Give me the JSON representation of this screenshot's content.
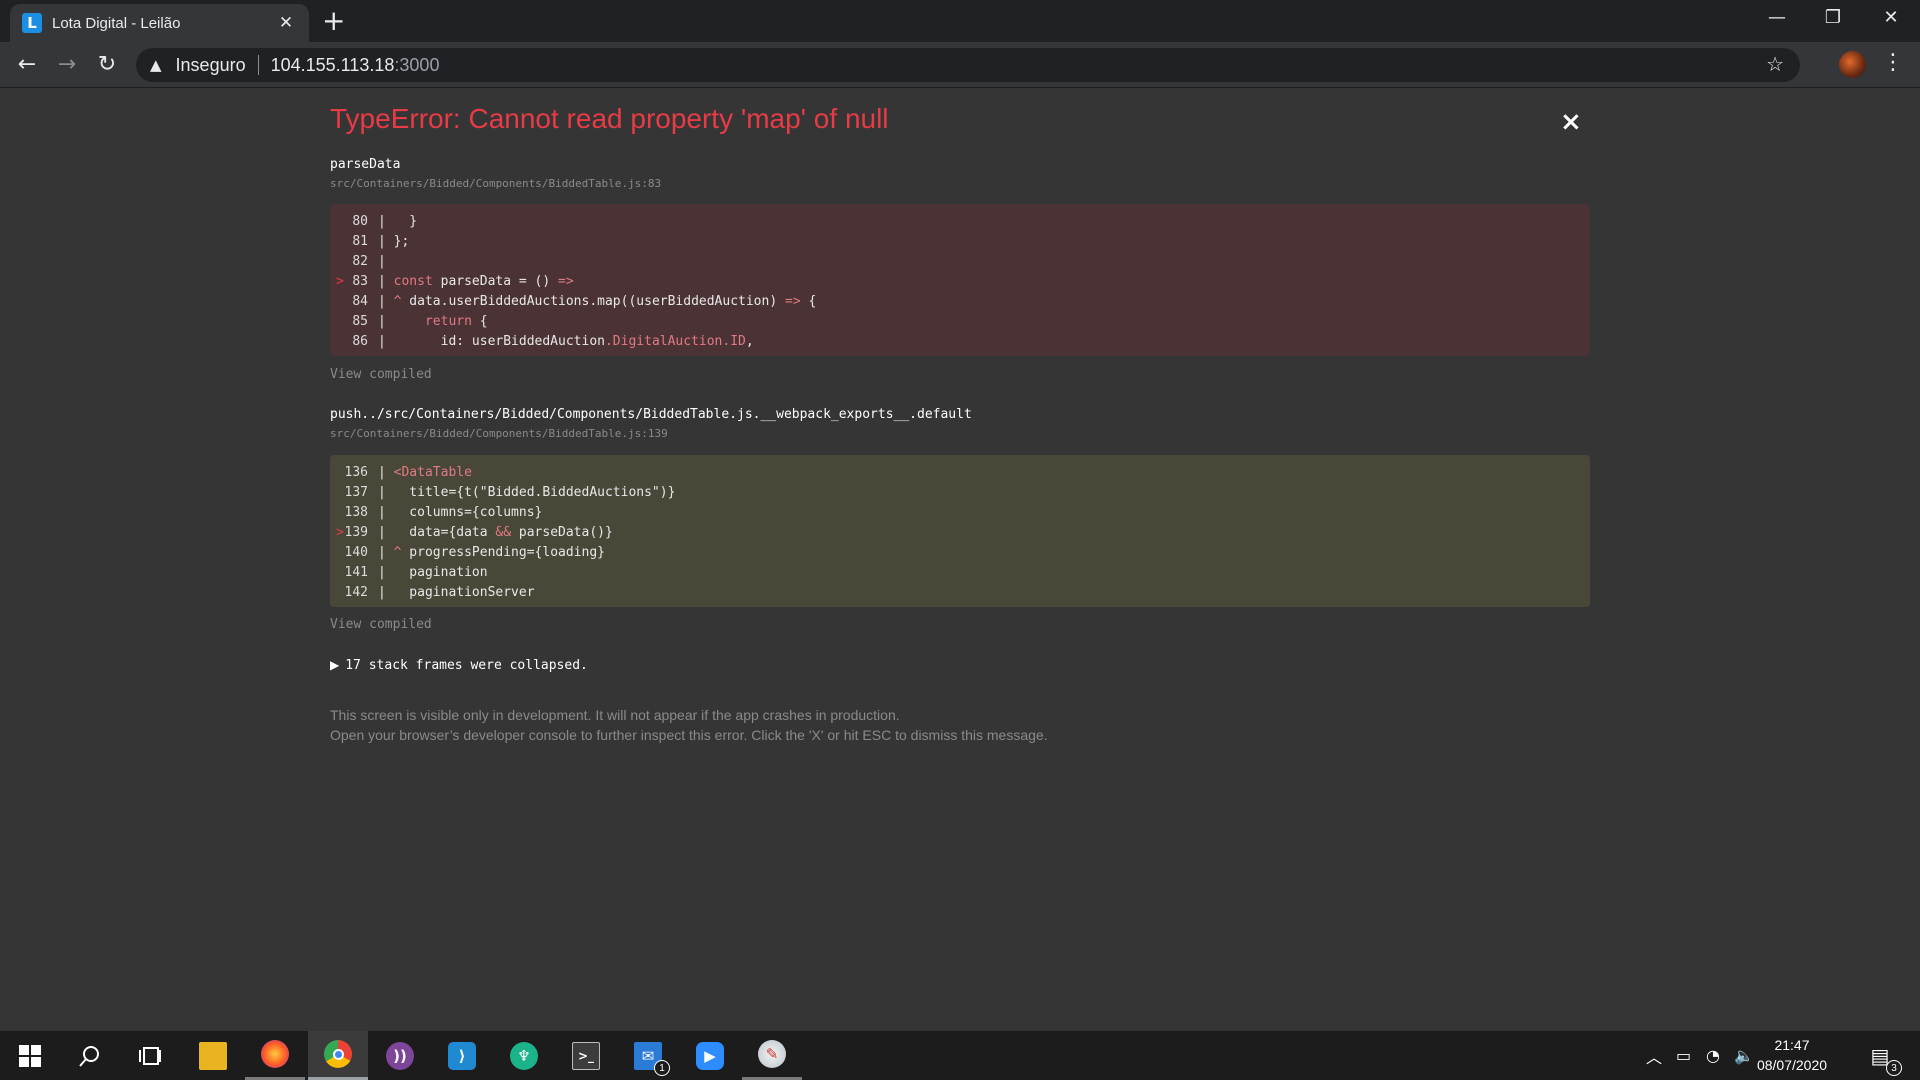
{
  "browser": {
    "tab_title": "Lota Digital - Leilão",
    "tab_favicon": "L",
    "close_tab": "✕",
    "new_tab": "+",
    "security_label": "Inseguro",
    "url_host": "104.155.113.18",
    "url_port": ":3000",
    "icons": [
      "back-icon",
      "forward-icon",
      "reload-icon",
      "warning-icon",
      "star-icon",
      "menu-icon"
    ]
  },
  "error": {
    "title": "TypeError: Cannot read property 'map' of null",
    "close": "×",
    "frames": [
      {
        "function": "parseData",
        "file": "src/Containers/Bidded/Components/BiddedTable.js:83",
        "lines": [
          {
            "n": "80",
            "code": "|   }",
            "mark": ""
          },
          {
            "n": "81",
            "code": "| };",
            "mark": ""
          },
          {
            "n": "82",
            "code": "|",
            "mark": ""
          },
          {
            "n": "83",
            "code": "| const parseData = () =>",
            "mark": ">"
          },
          {
            "n": "84",
            "code": "| ^ data.userBiddedAuctions.map((userBiddedAuction) => {",
            "mark": ""
          },
          {
            "n": "85",
            "code": "|     return {",
            "mark": ""
          },
          {
            "n": "86",
            "code": "|       id: userBiddedAuction.DigitalAuction.ID,",
            "mark": ""
          }
        ],
        "view_compiled": "View compiled"
      },
      {
        "function": "push../src/Containers/Bidded/Components/BiddedTable.js.__webpack_exports__.default",
        "file": "src/Containers/Bidded/Components/BiddedTable.js:139",
        "lines": [
          {
            "n": "136",
            "code": "| <DataTable",
            "mark": ""
          },
          {
            "n": "137",
            "code": "|   title={t(\"Bidded.BiddedAuctions\")}",
            "mark": ""
          },
          {
            "n": "138",
            "code": "|   columns={columns}",
            "mark": ""
          },
          {
            "n": "139",
            "code": "|   data={data && parseData()}",
            "mark": ">"
          },
          {
            "n": "140",
            "code": "| ^ progressPending={loading}",
            "mark": ""
          },
          {
            "n": "141",
            "code": "|   pagination",
            "mark": ""
          },
          {
            "n": "142",
            "code": "|   paginationServer",
            "mark": ""
          }
        ],
        "view_compiled": "View compiled"
      }
    ],
    "collapsed_text": "17 stack frames were collapsed.",
    "footer_line1": "This screen is visible only in development. It will not appear if the app crashes in production.",
    "footer_line2": "Open your browser’s developer console to further inspect this error.  Click the 'X' or hit ESC to dismiss this message."
  },
  "taskbar": {
    "apps": [
      "start-icon",
      "search-icon",
      "task-view-icon",
      "file-explorer-icon",
      "firefox-icon",
      "chrome-icon",
      "tor-icon",
      "vscode-icon",
      "gitkraken-icon",
      "terminal-icon",
      "mail-icon",
      "zoom-icon",
      "paint-icon"
    ],
    "mail_badge": "1",
    "notification_badge": "3",
    "time": "21:47",
    "date": "08/07/2020"
  },
  "colors": {
    "error_title": "#e83b46",
    "error_bg": "#353535",
    "frame1_bg": "#4b3234",
    "frame2_bg": "#494738"
  }
}
